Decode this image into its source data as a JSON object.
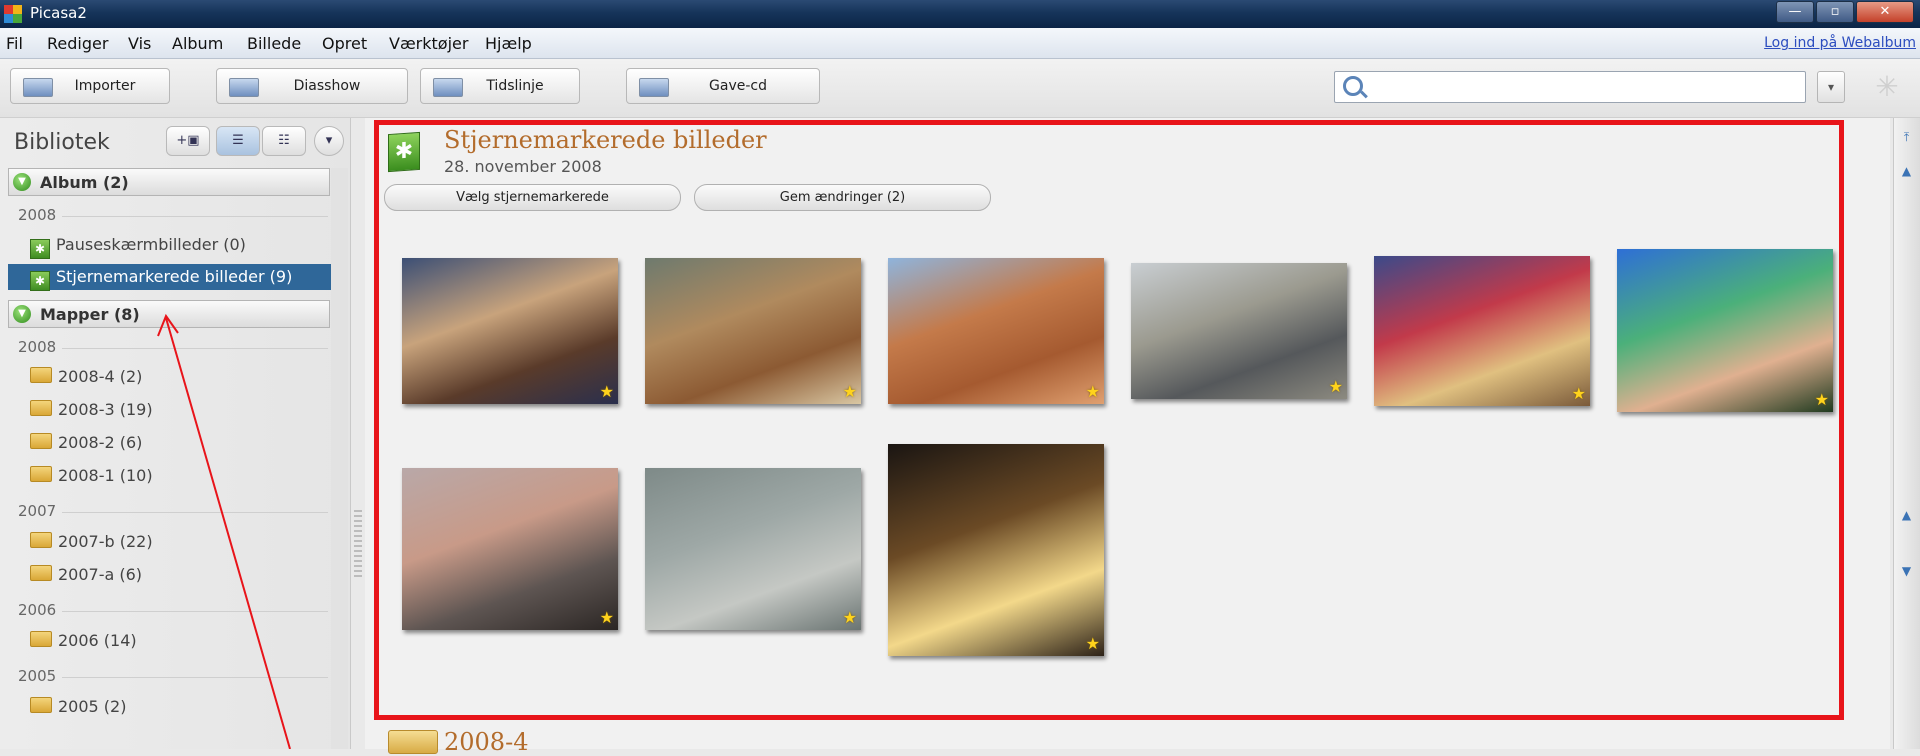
{
  "window": {
    "title": "Picasa2",
    "minimize": "—",
    "restore": "▫",
    "close": "✕"
  },
  "menu": {
    "items": [
      "Fil",
      "Rediger",
      "Vis",
      "Album",
      "Billede",
      "Opret",
      "Værktøjer",
      "Hjælp"
    ],
    "web_link": "Log ind på Webalbum"
  },
  "toolbar": {
    "buttons": [
      {
        "label": "Importer",
        "icon": "camera-icon"
      },
      {
        "label": "Diasshow",
        "icon": "slideshow-icon"
      },
      {
        "label": "Tidslinje",
        "icon": "timeline-icon"
      },
      {
        "label": "Gave-cd",
        "icon": "gift-cd-icon"
      }
    ],
    "search_value": ""
  },
  "sidebar": {
    "title": "Bibliotek",
    "album_section": "Album (2)",
    "folder_section": "Mapper (8)",
    "album_year": "2008",
    "albums": [
      "Pauseskærmbilleder (0)",
      "Stjernemarkerede billeder (9)"
    ],
    "folder_groups": [
      {
        "year": "2008",
        "folders": [
          "2008-4 (2)",
          "2008-3 (19)",
          "2008-2 (6)",
          "2008-1 (10)"
        ]
      },
      {
        "year": "2007",
        "folders": [
          "2007-b (22)",
          "2007-a (6)"
        ]
      },
      {
        "year": "2006",
        "folders": [
          "2006 (14)"
        ]
      },
      {
        "year": "2005",
        "folders": [
          "2005 (2)"
        ]
      }
    ]
  },
  "album": {
    "title": "Stjernemarkerede billeder",
    "date": "28. november 2008",
    "select_starred": "Vælg stjernemarkerede",
    "save_changes": "Gem ændringer (2)",
    "photos": [
      {
        "desc": "children",
        "colors": [
          "#3c4f75",
          "#c8a37c",
          "#5a3b2a",
          "#2a2f4d"
        ]
      },
      {
        "desc": "canyon",
        "colors": [
          "#6e7a6e",
          "#b08a5e",
          "#8c5a33",
          "#d9c7a3"
        ]
      },
      {
        "desc": "monument valley",
        "colors": [
          "#8fb4dc",
          "#c47a4a",
          "#a55a30",
          "#e0a070"
        ]
      },
      {
        "desc": "desert road",
        "colors": [
          "#c9ced2",
          "#9b9a8f",
          "#55585b",
          "#8c8a80"
        ]
      },
      {
        "desc": "child reading",
        "colors": [
          "#3b4a8a",
          "#c23a4a",
          "#e0c080",
          "#7a5a3a"
        ]
      },
      {
        "desc": "kids outdoors",
        "colors": [
          "#2e6fd6",
          "#4bb07a",
          "#e0b090",
          "#1f3a1f"
        ]
      },
      {
        "desc": "beach sunset",
        "colors": [
          "#b9a8a8",
          "#c89a88",
          "#5e5552",
          "#2b2624"
        ]
      },
      {
        "desc": "jellyfish",
        "colors": [
          "#7e8a88",
          "#9ea8a6",
          "#c5c8c4",
          "#6a7472"
        ]
      },
      {
        "desc": "candles",
        "colors": [
          "#1a1512",
          "#6b4a25",
          "#f3d88a",
          "#2d2218"
        ]
      }
    ],
    "next_folder": "2008-4"
  }
}
